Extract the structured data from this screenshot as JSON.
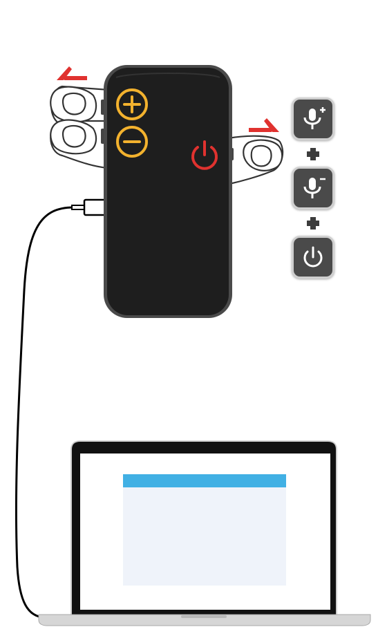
{
  "diagram": {
    "description": "",
    "device": {
      "buttons": [
        {
          "name": "volume-up",
          "glyph": "mic-plus"
        },
        {
          "name": "volume-down",
          "glyph": "mic-minus"
        },
        {
          "name": "power",
          "glyph": "power"
        }
      ]
    },
    "combo": {
      "keys": [
        {
          "icon": "mic-plus-icon"
        },
        {
          "icon": "mic-minus-icon"
        },
        {
          "icon": "power-icon"
        }
      ],
      "separator": "plus-icon"
    },
    "colors": {
      "device_body": "#1e1e1e",
      "device_bezel": "#4a4a4a",
      "volume_buttons": "#f3b22e",
      "power_button": "#e0322f",
      "arrow": "#e0322f",
      "key_bg": "#4a4a4a",
      "key_border": "#cfcfcf",
      "laptop_frame": "#111111",
      "laptop_base": "#d6d6d6",
      "window_titlebar": "#41b0e4",
      "window_body": "#eff3fa"
    }
  }
}
